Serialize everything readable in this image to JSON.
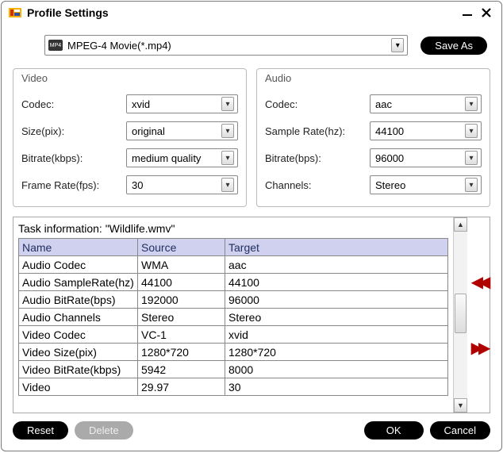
{
  "window": {
    "title": "Profile Settings"
  },
  "top": {
    "format_label": "MPEG-4 Movie(*.mp4)",
    "save_as": "Save As"
  },
  "video": {
    "title": "Video",
    "codec_label": "Codec:",
    "codec_value": "xvid",
    "size_label": "Size(pix):",
    "size_value": "original",
    "bitrate_label": "Bitrate(kbps):",
    "bitrate_value": "medium quality",
    "framerate_label": "Frame Rate(fps):",
    "framerate_value": "30"
  },
  "audio": {
    "title": "Audio",
    "codec_label": "Codec:",
    "codec_value": "aac",
    "samplerate_label": "Sample Rate(hz):",
    "samplerate_value": "44100",
    "bitrate_label": "Bitrate(bps):",
    "bitrate_value": "96000",
    "channels_label": "Channels:",
    "channels_value": "Stereo"
  },
  "task": {
    "title": "Task information: \"Wildlife.wmv\"",
    "headers": {
      "name": "Name",
      "source": "Source",
      "target": "Target"
    },
    "rows": [
      {
        "name": "Audio Codec",
        "source": "WMA",
        "target": "aac"
      },
      {
        "name": "Audio SampleRate(hz)",
        "source": "44100",
        "target": "44100"
      },
      {
        "name": "Audio BitRate(bps)",
        "source": "192000",
        "target": "96000"
      },
      {
        "name": "Audio Channels",
        "source": "Stereo",
        "target": "Stereo"
      },
      {
        "name": "Video Codec",
        "source": "VC-1",
        "target": "xvid"
      },
      {
        "name": "Video Size(pix)",
        "source": "1280*720",
        "target": "1280*720"
      },
      {
        "name": "Video BitRate(kbps)",
        "source": "5942",
        "target": "8000"
      },
      {
        "name": "Video",
        "source": "29.97",
        "target": "30"
      }
    ]
  },
  "footer": {
    "reset": "Reset",
    "delete": "Delete",
    "ok": "OK",
    "cancel": "Cancel"
  }
}
